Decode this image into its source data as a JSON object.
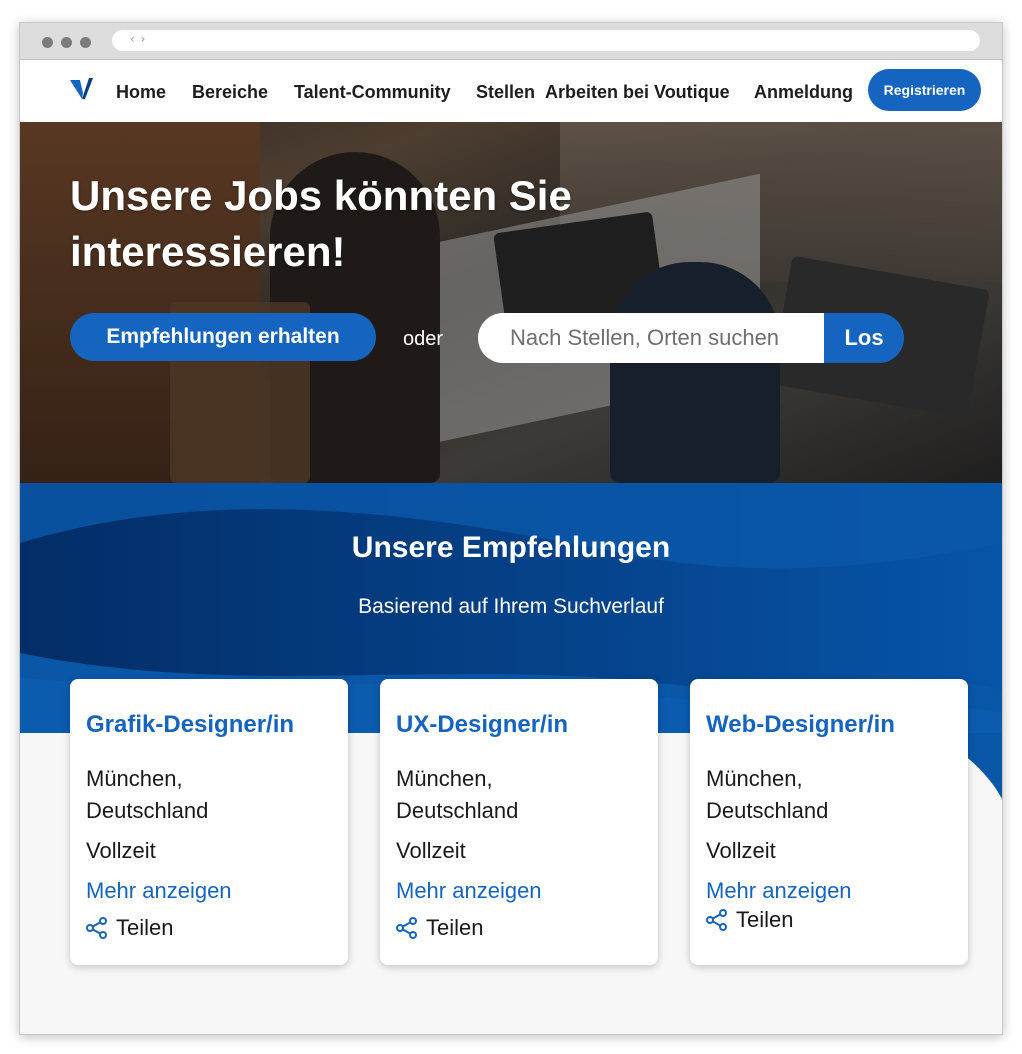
{
  "nav": {
    "items": [
      "Home",
      "Bereiche",
      "Talent-Community",
      "Stellen",
      "Arbeiten bei Voutique",
      "Anmeldung"
    ],
    "register_label": "Registrieren"
  },
  "hero": {
    "title": "Unsere Jobs könnten Sie interessieren!",
    "reco_button": "Empfehlungen erhalten",
    "or_label": "oder",
    "search_placeholder": "Nach Stellen, Orten suchen",
    "search_button": "Los"
  },
  "recommendations": {
    "title": "Unsere Empfehlungen",
    "subtitle": "Basierend auf Ihrem Suchverlauf",
    "cards": [
      {
        "title": "Grafik-Designer/in",
        "location": "München, Deutschland",
        "type": "Vollzeit",
        "more": "Mehr anzeigen",
        "share": "Teilen"
      },
      {
        "title": "UX-Designer/in",
        "location": "München, Deutschland",
        "type": "Vollzeit",
        "more": "Mehr anzeigen",
        "share": "Teilen"
      },
      {
        "title": "Web-Designer/in",
        "location": "München, Deutschland",
        "type": "Vollzeit",
        "more": "Mehr anzeigen",
        "share": "Teilen"
      }
    ]
  },
  "colors": {
    "accent": "#1565c0",
    "band_dark": "#022a62",
    "band_light": "#0a58aa"
  }
}
